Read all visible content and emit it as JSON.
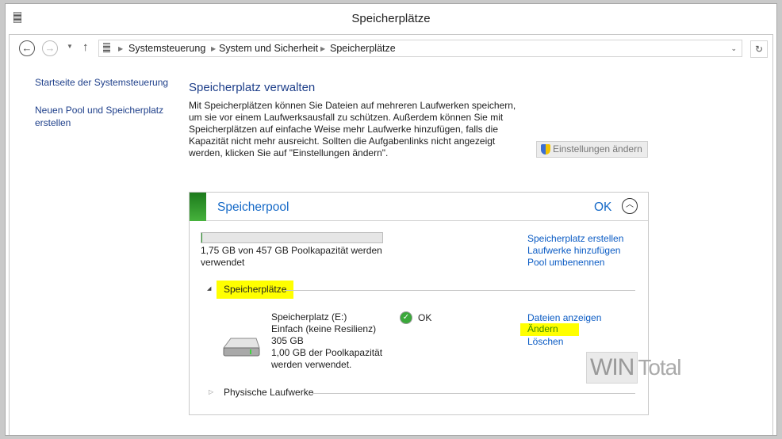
{
  "window": {
    "title": "Speicherplätze"
  },
  "address": {
    "crumbs": [
      "Systemsteuerung",
      "System und Sicherheit",
      "Speicherplätze"
    ]
  },
  "sidebar": {
    "items": [
      {
        "label": "Startseite der Systemsteuerung"
      },
      {
        "label": "Neuen Pool und Speicherplatz erstellen"
      }
    ]
  },
  "main": {
    "title": "Speicherplatz verwalten",
    "description": "Mit Speicherplätzen können Sie Dateien auf mehreren Laufwerken speichern, um sie vor einem Laufwerksausfall zu schützen. Außerdem können Sie mit Speicherplätzen auf einfache Weise mehr Laufwerke hinzufügen, falls die Kapazität nicht mehr ausreicht. Sollten die Aufgabenlinks nicht angezeigt werden, klicken Sie auf \"Einstellungen ändern\".",
    "settings_button": "Einstellungen ändern"
  },
  "pool": {
    "name": "Speicherpool",
    "status": "OK",
    "usage_fraction": 0.004,
    "usage_text": "1,75 GB von 457 GB Poolkapazität werden verwendet",
    "actions": [
      "Speicherplatz erstellen",
      "Laufwerke hinzufügen",
      "Pool umbenennen"
    ],
    "spaces_header": "Speicherplätze",
    "space": {
      "name": "Speicherplatz (E:)",
      "type": "Einfach (keine Resilienz)",
      "size": "305 GB",
      "usage": "1,00 GB der Poolkapazität werden verwendet.",
      "status": "OK",
      "actions": [
        "Dateien anzeigen",
        "Ändern",
        "Löschen"
      ]
    },
    "drives_header": "Physische Laufwerke"
  },
  "watermark": {
    "text1": "WIN",
    "text2": "Total"
  },
  "colors": {
    "accent_link": "#0a5bc4",
    "pool_ok_green": "#2e9a2e",
    "highlight": "#ffff00"
  }
}
